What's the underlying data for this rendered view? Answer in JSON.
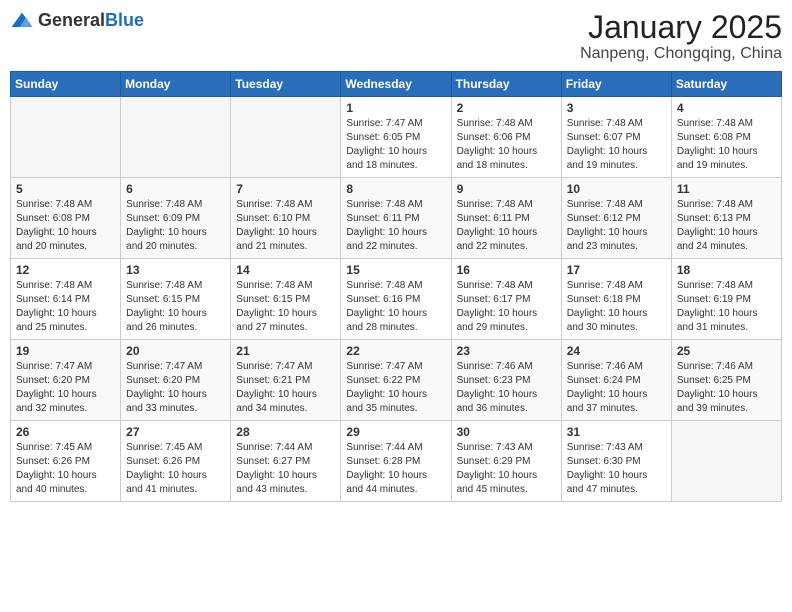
{
  "header": {
    "logo_general": "General",
    "logo_blue": "Blue",
    "month_year": "January 2025",
    "location": "Nanpeng, Chongqing, China"
  },
  "calendar": {
    "days_of_week": [
      "Sunday",
      "Monday",
      "Tuesday",
      "Wednesday",
      "Thursday",
      "Friday",
      "Saturday"
    ],
    "weeks": [
      {
        "days": [
          {
            "num": "",
            "info": ""
          },
          {
            "num": "",
            "info": ""
          },
          {
            "num": "",
            "info": ""
          },
          {
            "num": "1",
            "info": "Sunrise: 7:47 AM\nSunset: 6:05 PM\nDaylight: 10 hours and 18 minutes."
          },
          {
            "num": "2",
            "info": "Sunrise: 7:48 AM\nSunset: 6:06 PM\nDaylight: 10 hours and 18 minutes."
          },
          {
            "num": "3",
            "info": "Sunrise: 7:48 AM\nSunset: 6:07 PM\nDaylight: 10 hours and 19 minutes."
          },
          {
            "num": "4",
            "info": "Sunrise: 7:48 AM\nSunset: 6:08 PM\nDaylight: 10 hours and 19 minutes."
          }
        ]
      },
      {
        "days": [
          {
            "num": "5",
            "info": "Sunrise: 7:48 AM\nSunset: 6:08 PM\nDaylight: 10 hours and 20 minutes."
          },
          {
            "num": "6",
            "info": "Sunrise: 7:48 AM\nSunset: 6:09 PM\nDaylight: 10 hours and 20 minutes."
          },
          {
            "num": "7",
            "info": "Sunrise: 7:48 AM\nSunset: 6:10 PM\nDaylight: 10 hours and 21 minutes."
          },
          {
            "num": "8",
            "info": "Sunrise: 7:48 AM\nSunset: 6:11 PM\nDaylight: 10 hours and 22 minutes."
          },
          {
            "num": "9",
            "info": "Sunrise: 7:48 AM\nSunset: 6:11 PM\nDaylight: 10 hours and 22 minutes."
          },
          {
            "num": "10",
            "info": "Sunrise: 7:48 AM\nSunset: 6:12 PM\nDaylight: 10 hours and 23 minutes."
          },
          {
            "num": "11",
            "info": "Sunrise: 7:48 AM\nSunset: 6:13 PM\nDaylight: 10 hours and 24 minutes."
          }
        ]
      },
      {
        "days": [
          {
            "num": "12",
            "info": "Sunrise: 7:48 AM\nSunset: 6:14 PM\nDaylight: 10 hours and 25 minutes."
          },
          {
            "num": "13",
            "info": "Sunrise: 7:48 AM\nSunset: 6:15 PM\nDaylight: 10 hours and 26 minutes."
          },
          {
            "num": "14",
            "info": "Sunrise: 7:48 AM\nSunset: 6:15 PM\nDaylight: 10 hours and 27 minutes."
          },
          {
            "num": "15",
            "info": "Sunrise: 7:48 AM\nSunset: 6:16 PM\nDaylight: 10 hours and 28 minutes."
          },
          {
            "num": "16",
            "info": "Sunrise: 7:48 AM\nSunset: 6:17 PM\nDaylight: 10 hours and 29 minutes."
          },
          {
            "num": "17",
            "info": "Sunrise: 7:48 AM\nSunset: 6:18 PM\nDaylight: 10 hours and 30 minutes."
          },
          {
            "num": "18",
            "info": "Sunrise: 7:48 AM\nSunset: 6:19 PM\nDaylight: 10 hours and 31 minutes."
          }
        ]
      },
      {
        "days": [
          {
            "num": "19",
            "info": "Sunrise: 7:47 AM\nSunset: 6:20 PM\nDaylight: 10 hours and 32 minutes."
          },
          {
            "num": "20",
            "info": "Sunrise: 7:47 AM\nSunset: 6:20 PM\nDaylight: 10 hours and 33 minutes."
          },
          {
            "num": "21",
            "info": "Sunrise: 7:47 AM\nSunset: 6:21 PM\nDaylight: 10 hours and 34 minutes."
          },
          {
            "num": "22",
            "info": "Sunrise: 7:47 AM\nSunset: 6:22 PM\nDaylight: 10 hours and 35 minutes."
          },
          {
            "num": "23",
            "info": "Sunrise: 7:46 AM\nSunset: 6:23 PM\nDaylight: 10 hours and 36 minutes."
          },
          {
            "num": "24",
            "info": "Sunrise: 7:46 AM\nSunset: 6:24 PM\nDaylight: 10 hours and 37 minutes."
          },
          {
            "num": "25",
            "info": "Sunrise: 7:46 AM\nSunset: 6:25 PM\nDaylight: 10 hours and 39 minutes."
          }
        ]
      },
      {
        "days": [
          {
            "num": "26",
            "info": "Sunrise: 7:45 AM\nSunset: 6:26 PM\nDaylight: 10 hours and 40 minutes."
          },
          {
            "num": "27",
            "info": "Sunrise: 7:45 AM\nSunset: 6:26 PM\nDaylight: 10 hours and 41 minutes."
          },
          {
            "num": "28",
            "info": "Sunrise: 7:44 AM\nSunset: 6:27 PM\nDaylight: 10 hours and 43 minutes."
          },
          {
            "num": "29",
            "info": "Sunrise: 7:44 AM\nSunset: 6:28 PM\nDaylight: 10 hours and 44 minutes."
          },
          {
            "num": "30",
            "info": "Sunrise: 7:43 AM\nSunset: 6:29 PM\nDaylight: 10 hours and 45 minutes."
          },
          {
            "num": "31",
            "info": "Sunrise: 7:43 AM\nSunset: 6:30 PM\nDaylight: 10 hours and 47 minutes."
          },
          {
            "num": "",
            "info": ""
          }
        ]
      }
    ]
  }
}
